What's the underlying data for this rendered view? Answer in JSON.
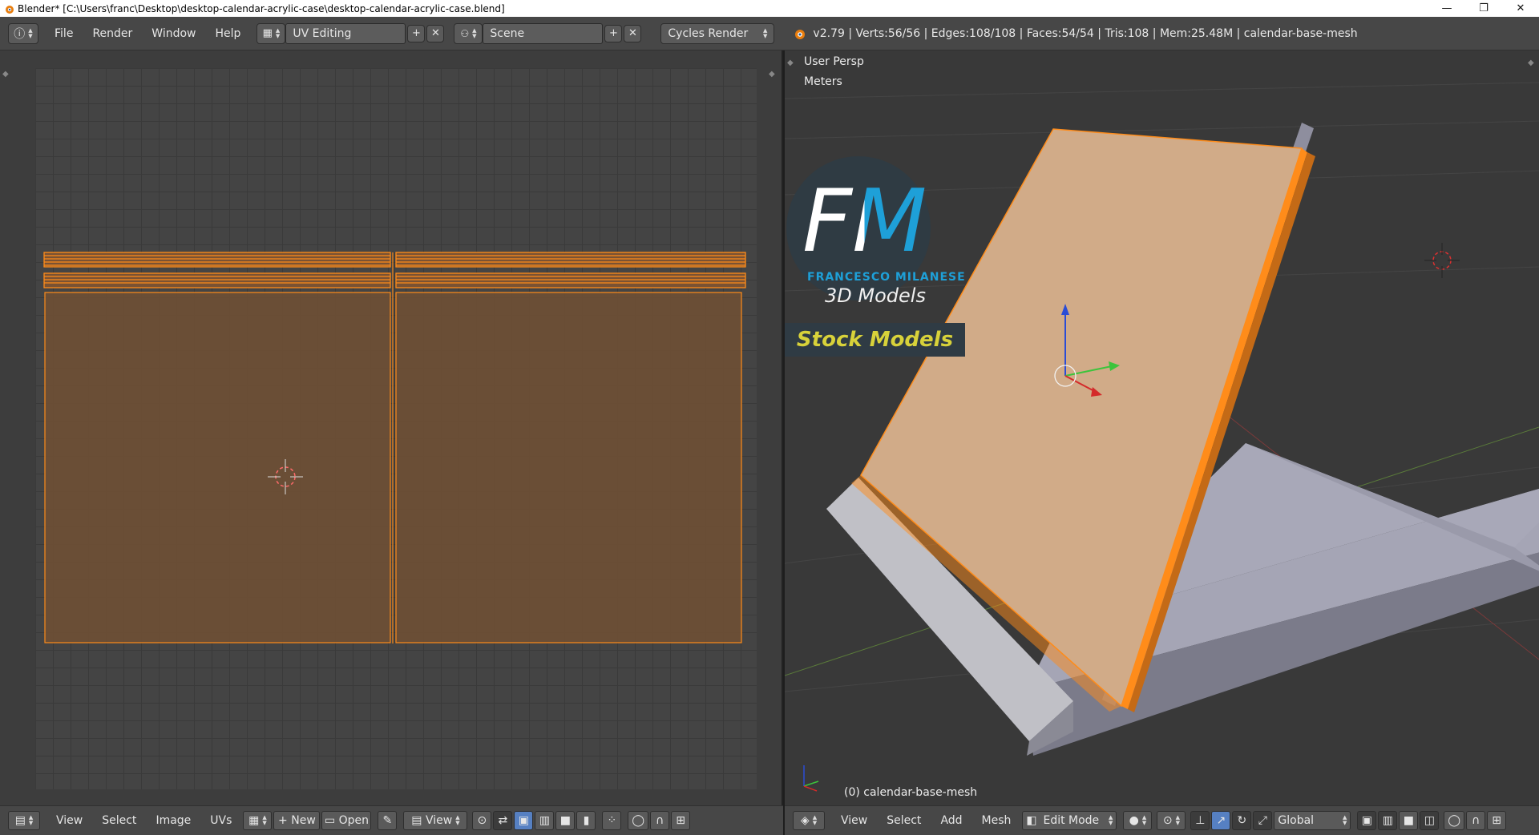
{
  "window": {
    "title": "Blender* [C:\\Users\\franc\\Desktop\\desktop-calendar-acrylic-case\\desktop-calendar-acrylic-case.blend]",
    "minimize": "—",
    "maximize": "❐",
    "close": "✕"
  },
  "info_header": {
    "menus": [
      "File",
      "Render",
      "Window",
      "Help"
    ],
    "layout": "UV Editing",
    "scene": "Scene",
    "engine": "Cycles Render",
    "stats": "v2.79 | Verts:56/56 | Edges:108/108 | Faces:54/54 | Tris:108 | Mem:25.48M | calendar-base-mesh"
  },
  "uv_header": {
    "menus": [
      "View",
      "Select",
      "Image",
      "UVs"
    ],
    "new_label": "New",
    "open_label": "Open",
    "view_label": "View"
  },
  "viewport": {
    "persp_label": "User Persp",
    "units_label": "Meters",
    "object_label": "(0) calendar-base-mesh",
    "logo_line1": "FM",
    "logo_line2": "FRANCESCO MILANESE",
    "logo_line3": "3D Models",
    "logo_banner": "Stock Models"
  },
  "view3d_header": {
    "menus": [
      "View",
      "Select",
      "Add",
      "Mesh"
    ],
    "mode": "Edit Mode",
    "orientation": "Global"
  },
  "colors": {
    "accent_orange": "#ff8c1a",
    "uv_face_fill": "#6e4f35",
    "mesh_face": "#d1ab88",
    "mesh_body": "#a8a8b8",
    "logo_blue": "#1ea0d8",
    "banner_text": "#d8d23a"
  }
}
